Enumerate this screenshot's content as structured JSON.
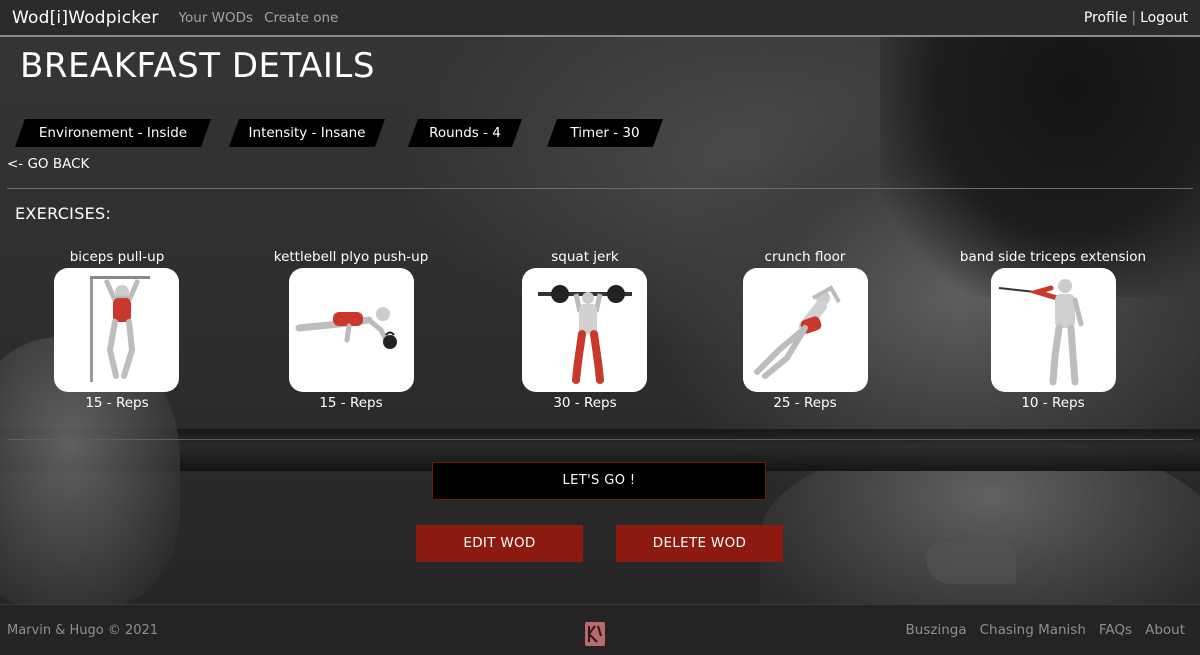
{
  "nav": {
    "brand": "Wod[i]Wodpicker",
    "links": [
      "Your WODs",
      "Create one"
    ],
    "profile": "Profile",
    "separator": "|",
    "logout": "Logout"
  },
  "page": {
    "title": "BREAKFAST DETAILS",
    "tags": [
      "Environement - Inside",
      "Intensity - Insane",
      "Rounds - 4",
      "Timer - 30"
    ],
    "back_link": "<- GO BACK",
    "exercises_label": "EXERCISES:"
  },
  "exercises": [
    {
      "name": "biceps pull-up",
      "reps": "15 - Reps",
      "icon": "pull-up-illustration"
    },
    {
      "name": "kettlebell plyo push-up",
      "reps": "15 - Reps",
      "icon": "push-up-illustration"
    },
    {
      "name": "squat jerk",
      "reps": "30 - Reps",
      "icon": "barbell-jerk-illustration"
    },
    {
      "name": "crunch floor",
      "reps": "25 - Reps",
      "icon": "crunch-illustration"
    },
    {
      "name": "band side triceps extension",
      "reps": "10 - Reps",
      "icon": "band-extension-illustration"
    }
  ],
  "actions": {
    "start": "LET'S GO !",
    "edit": "EDIT WOD",
    "delete": "DELETE WOD"
  },
  "footer": {
    "copyright": "Marvin & Hugo © 2021",
    "links": [
      "Buszinga",
      "Chasing Manish",
      "FAQs",
      "About"
    ]
  },
  "colors": {
    "accent_red": "#8d1a10",
    "muscle_red": "#c9382c",
    "topbar": "#2b2b2b",
    "footer": "#252323"
  }
}
